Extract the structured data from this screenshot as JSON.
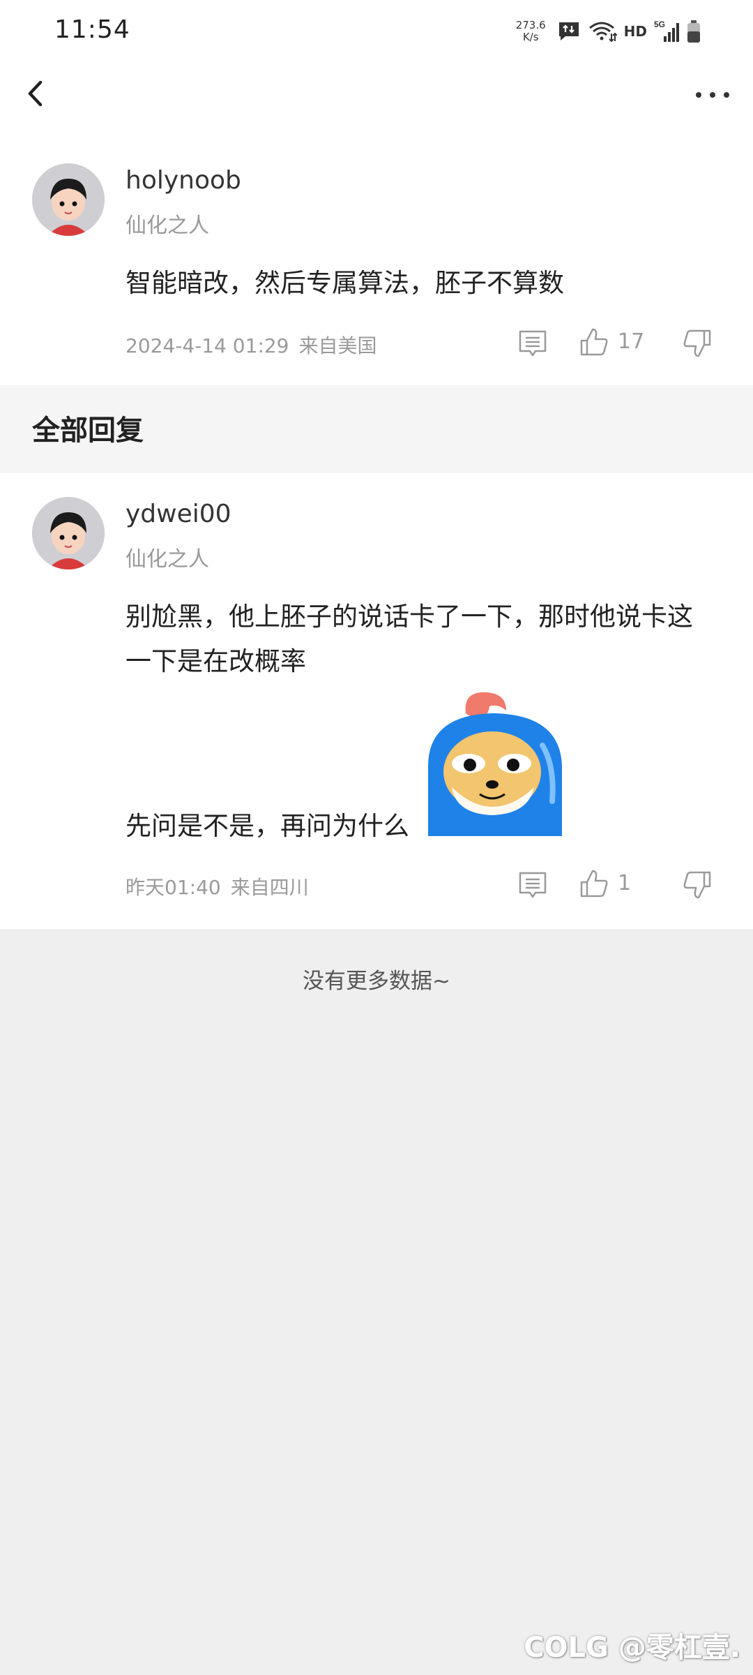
{
  "status_bar": {
    "time": "11:54",
    "net_speed_value": "273.6",
    "net_speed_unit": "K/s",
    "network_label": "HD",
    "signal_label": "5G",
    "icons": [
      "message-sync-icon",
      "wifi-icon",
      "signal-icon",
      "battery-icon"
    ]
  },
  "nav": {
    "back_icon": "chevron-left-icon",
    "more_icon": "more-dots-icon"
  },
  "main_comment": {
    "username": "holynoob",
    "rank": "仙化之人",
    "text": "智能暗改，然后专属算法，胚子不算数",
    "date": "2024-4-14 01:29",
    "location": "来自美国",
    "likes": "17"
  },
  "section": {
    "title": "全部回复"
  },
  "replies": [
    {
      "username": "ydwei00",
      "rank": "仙化之人",
      "text_line1": "别尬黑，他上胚子的说话卡了一下，那时他说卡这",
      "text_line2": "一下是在改概率",
      "text_line3": "先问是不是，再问为什么",
      "date": "昨天01:40",
      "location": "来自四川",
      "likes": "1",
      "sticker": "doge-mascot-sticker"
    }
  ],
  "footer": {
    "no_more": "没有更多数据~",
    "watermark": "COLG @零杠壹."
  },
  "colors": {
    "background": "#efefef",
    "card": "#ffffff",
    "text_primary": "#222222",
    "text_secondary": "#9a9a9a",
    "sticker_blue": "#1f82e8"
  }
}
